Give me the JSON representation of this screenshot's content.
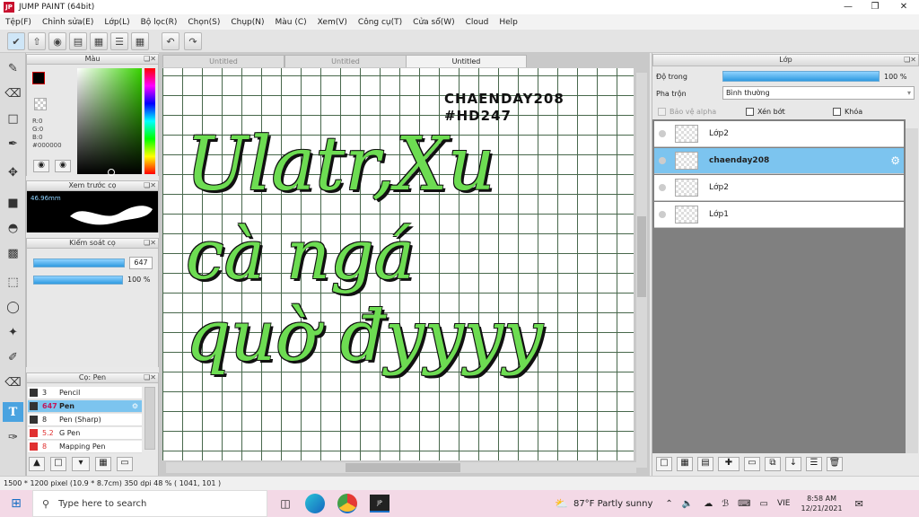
{
  "window": {
    "title": "JUMP PAINT (64bit)",
    "app_icon": "JP"
  },
  "menu": [
    "Tệp(F)",
    "Chỉnh sửa(E)",
    "Lớp(L)",
    "Bộ lọc(R)",
    "Chọn(S)",
    "Chụp(N)",
    "Màu (C)",
    "Xem(V)",
    "Công cụ(T)",
    "Cửa sổ(W)",
    "Cloud",
    "Help"
  ],
  "color_panel": {
    "title": "Màu",
    "r": "R:0",
    "g": "G:0",
    "b": "B:0",
    "hex": "#000000"
  },
  "brush_preview": {
    "title": "Xem trước cọ",
    "size": "46.96mm"
  },
  "brush_control": {
    "title": "Kiểm soát cọ",
    "size_value": "647",
    "opacity_value": "100 %"
  },
  "brush_list": {
    "title": "Cọ: Pen",
    "items": [
      {
        "size": "3",
        "name": "Pencil",
        "color": "#333333",
        "selected": false
      },
      {
        "size": "647",
        "name": "Pen",
        "color": "#333333",
        "selected": true
      },
      {
        "size": "8",
        "name": "Pen (Sharp)",
        "color": "#333333",
        "selected": false
      },
      {
        "size": "5.2",
        "name": "G Pen",
        "color": "#e03030",
        "selected": false
      },
      {
        "size": "8",
        "name": "Mapping Pen",
        "color": "#e03030",
        "selected": false
      }
    ]
  },
  "tabs": [
    "Untitled",
    "Untitled",
    "Untitled"
  ],
  "canvas": {
    "watermark_1": "CHAENDAY208",
    "watermark_2": "#HD247",
    "line_1": "Ulatr,Xu",
    "line_2": "cà ngá",
    "line_3": "quờ đyyyy"
  },
  "layer_panel": {
    "title": "Lớp",
    "opacity_label": "Độ trong",
    "opacity_value": "100 %",
    "opacity_fraction": 1.0,
    "blend_label": "Pha trộn",
    "blend_value": "Bình thường",
    "protect_alpha": "Bảo vệ alpha",
    "clip": "Xén bớt",
    "lock": "Khóa",
    "layers": [
      {
        "name": "Lớp2",
        "selected": false
      },
      {
        "name": "chaenday208",
        "selected": true
      },
      {
        "name": "Lớp2",
        "selected": false
      },
      {
        "name": "Lớp1",
        "selected": false
      }
    ]
  },
  "statusbar": {
    "text": "1500 * 1200 pixel   (10.9 * 8.7cm)   350 dpi   48 %   ( 1041, 101 )"
  },
  "taskbar": {
    "search_placeholder": "Type here to search",
    "weather": "87°F  Partly sunny",
    "lang": "VIE",
    "time": "8:58 AM",
    "date": "12/21/2021"
  },
  "colors": {
    "accent": "#4aa3e0",
    "selected_row": "#7cc4ef",
    "lettering": "#6ddc52"
  }
}
